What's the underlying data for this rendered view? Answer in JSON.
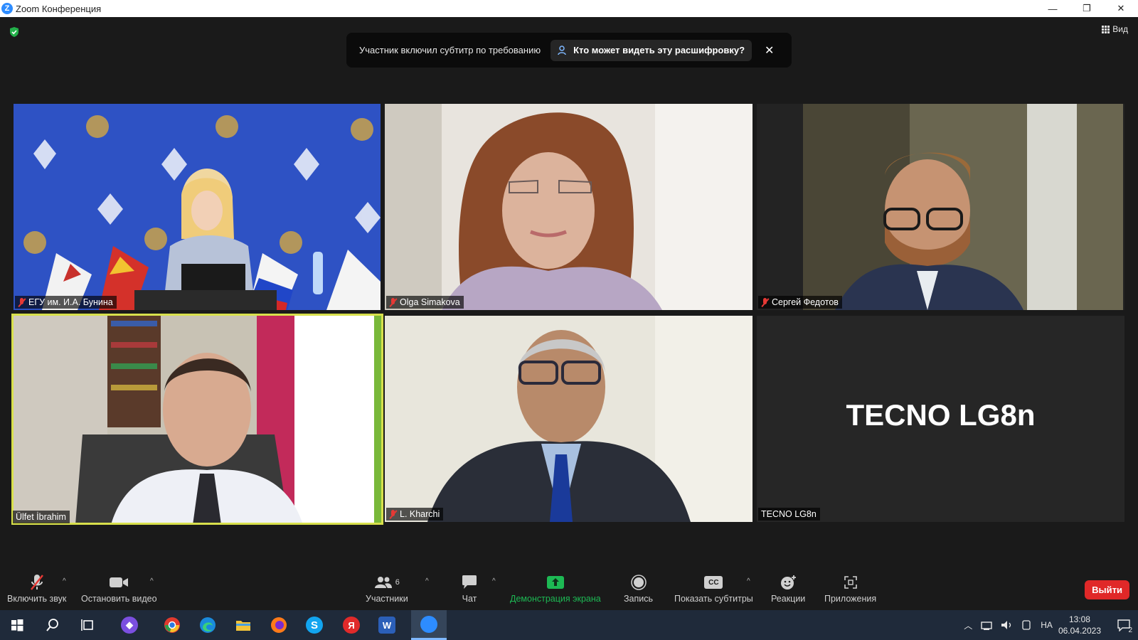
{
  "window": {
    "title": "Zoom Конференция",
    "app_icon_letter": "Z",
    "minimize": "—",
    "restore": "❐",
    "close": "✕"
  },
  "view_button": {
    "label": "Вид"
  },
  "caption_banner": {
    "message": "Участник включил субтитр по требованию",
    "button_label": "Кто может видеть эту расшифровку?",
    "close": "✕"
  },
  "participants": [
    {
      "name": "ЕГУ им. И.А. Бунина",
      "muted": true
    },
    {
      "name": "Olga Simakova",
      "muted": true
    },
    {
      "name": "Сергей Федотов",
      "muted": true
    },
    {
      "name": "Ülfet İbrahim",
      "muted": false,
      "active_speaker": true
    },
    {
      "name": "L. Kharchi",
      "muted": true
    },
    {
      "name": "TECNO LG8n",
      "muted": false,
      "video_off": true,
      "display_text": "TECNO LG8n"
    }
  ],
  "toolbar": {
    "unmute": "Включить звук",
    "stop_video": "Остановить видео",
    "participants": "Участники",
    "participants_count": "6",
    "chat": "Чат",
    "share_screen": "Демонстрация экрана",
    "record": "Запись",
    "captions": "Показать субтитры",
    "captions_icon": "CC",
    "reactions": "Реакции",
    "apps": "Приложения",
    "leave": "Выйти",
    "caret": "^"
  },
  "taskbar": {
    "language": "НА",
    "time": "13:08",
    "date": "06.04.2023",
    "notification_count": "2",
    "icons": [
      "windows-start",
      "search",
      "task-view",
      "viber",
      "chrome",
      "edge",
      "file-explorer",
      "firefox",
      "skype",
      "yandex",
      "word",
      "zoom"
    ]
  },
  "colors": {
    "share_green": "#1db954",
    "leave_red": "#e02828",
    "active_speaker": "#d8e04c",
    "muted_red": "#e53935",
    "taskbar": "#1f2a3a"
  }
}
